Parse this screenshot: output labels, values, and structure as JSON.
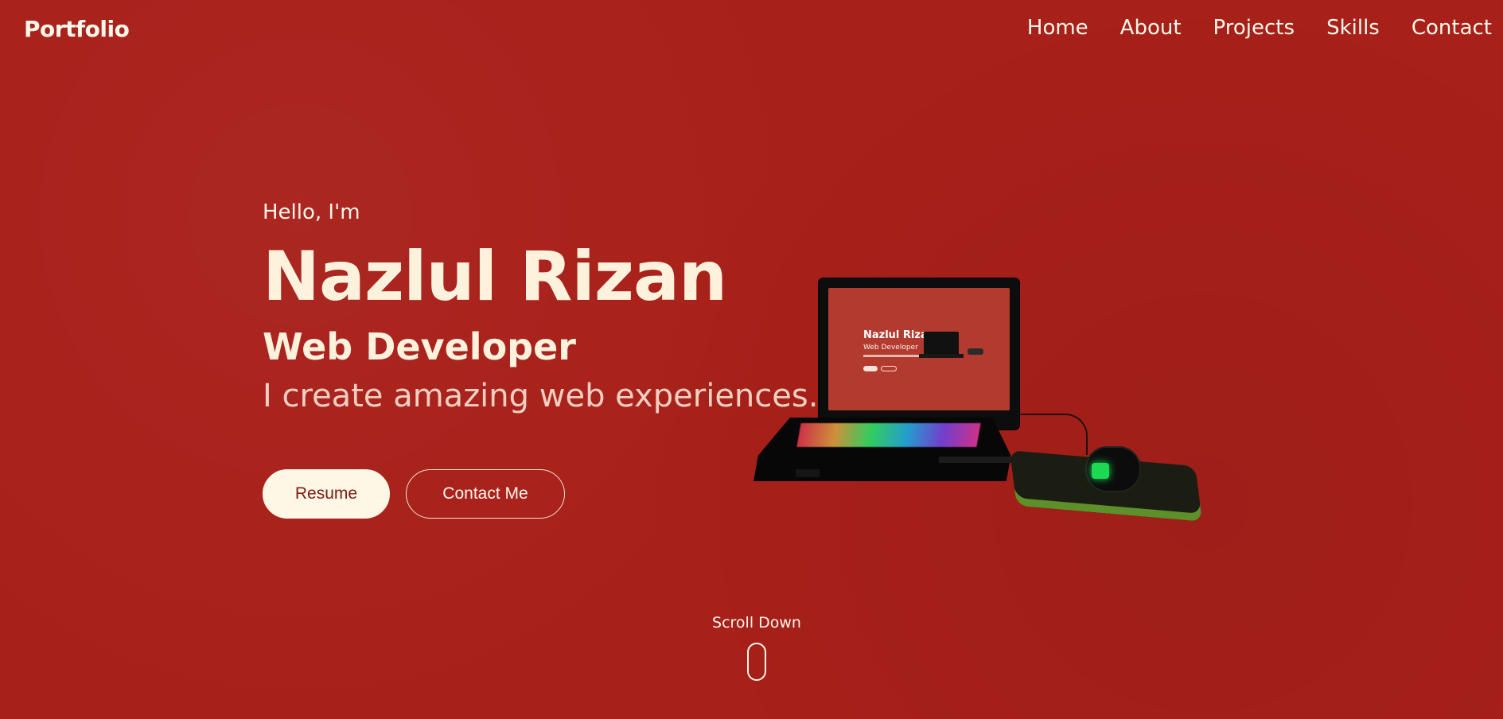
{
  "navbar": {
    "logo": "Portfolio",
    "links": [
      "Home",
      "About",
      "Projects",
      "Skills",
      "Contact"
    ]
  },
  "hero": {
    "greeting": "Hello, I'm",
    "name": "Nazlul Rizan",
    "role": "Web Developer",
    "tagline": "I create amazing web experiences.",
    "buttons": {
      "resume": "Resume",
      "contact": "Contact Me"
    }
  },
  "illustration": {
    "screen_name": "Nazlul Rizan",
    "screen_role": "Web Developer"
  },
  "scroll": {
    "label": "Scroll Down"
  },
  "colors": {
    "background": "#a8201a",
    "text": "#fff6ea",
    "button_fill": "#fff7e6",
    "button_text": "#7e1a14"
  }
}
